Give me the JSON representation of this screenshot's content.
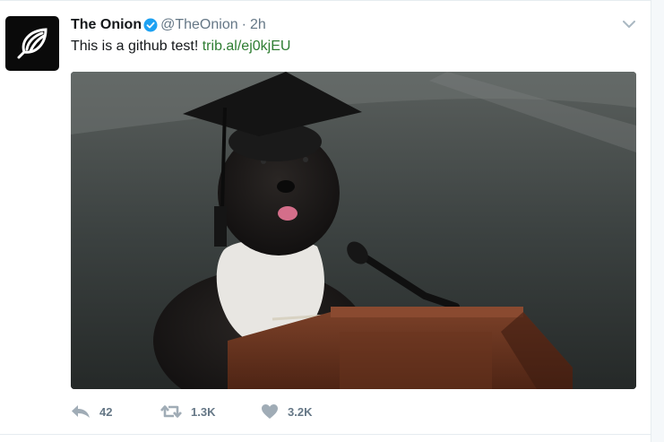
{
  "tweet": {
    "author_name": "The Onion",
    "handle": "@TheOnion",
    "separator": "·",
    "time": "2h",
    "text": "This is a github test! ",
    "link_text": "trib.al/ej0kjEU",
    "link_color": "#2e7d32",
    "verified_color": "#1da1f2"
  },
  "actions": {
    "reply_count": "42",
    "retweet_count": "1.3K",
    "like_count": "3.2K"
  },
  "media": {
    "description_icon": "graduation-dog-photo"
  },
  "colors": {
    "text_primary": "#14171a",
    "text_secondary": "#657786",
    "card_border": "#e6ecf0"
  }
}
